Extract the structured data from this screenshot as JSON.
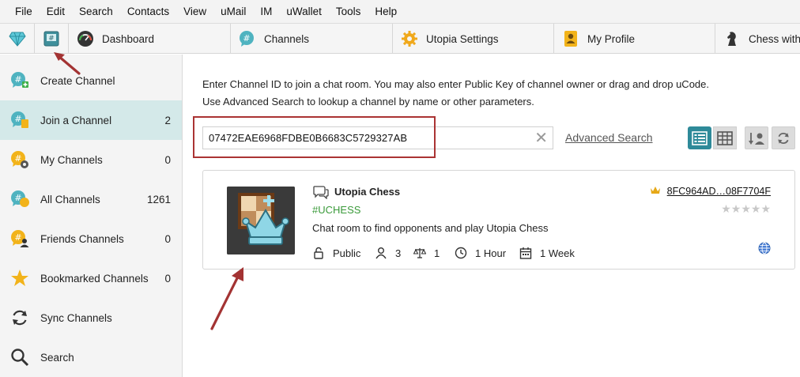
{
  "menu": [
    "File",
    "Edit",
    "Search",
    "Contacts",
    "View",
    "uMail",
    "IM",
    "uWallet",
    "Tools",
    "Help"
  ],
  "tabs": [
    {
      "label": "Dashboard",
      "icon": "dashboard-gauge-icon"
    },
    {
      "label": "Channels",
      "icon": "channels-chat-icon"
    },
    {
      "label": "Utopia Settings",
      "icon": "settings-gear-icon"
    },
    {
      "label": "My Profile",
      "icon": "profile-card-icon"
    },
    {
      "label": "Chess with",
      "icon": "chess-knight-icon"
    }
  ],
  "sidebar": {
    "items": [
      {
        "label": "Create Channel",
        "count": "",
        "icon": "create-channel-icon"
      },
      {
        "label": "Join a Channel",
        "count": "2",
        "icon": "join-channel-icon"
      },
      {
        "label": "My Channels",
        "count": "0",
        "icon": "my-channels-icon"
      },
      {
        "label": "All Channels",
        "count": "1261",
        "icon": "all-channels-icon"
      },
      {
        "label": "Friends Channels",
        "count": "0",
        "icon": "friends-channels-icon"
      },
      {
        "label": "Bookmarked Channels",
        "count": "0",
        "icon": "star-icon"
      },
      {
        "label": "Sync Channels",
        "count": "",
        "icon": "sync-icon"
      },
      {
        "label": "Search",
        "count": "",
        "icon": "search-icon"
      }
    ]
  },
  "main": {
    "info_line1": "Enter Channel ID to join a chat room. You may also enter Public Key of channel owner or drag and drop uCode.",
    "info_line2": "Use Advanced Search to lookup a channel by name or other parameters.",
    "search_value": "07472EAE6968FDBE0B6683C5729327AB",
    "clear_symbol": "✕",
    "advanced_search": "Advanced Search"
  },
  "channel": {
    "title": "Utopia Chess",
    "tag": "#UCHESS",
    "description": "Chat room to find opponents and play Utopia Chess",
    "owner": "8FC964AD…08F7704F",
    "stars": "★★★★★",
    "access": "Public",
    "members": "3",
    "moderators": "1",
    "hour": "1 Hour",
    "week": "1 Week"
  },
  "colors": {
    "active_item": "#d4e9e9",
    "accent": "#2e8a99",
    "tag_green": "#3a9a3a",
    "annotation_red": "#a33333"
  }
}
